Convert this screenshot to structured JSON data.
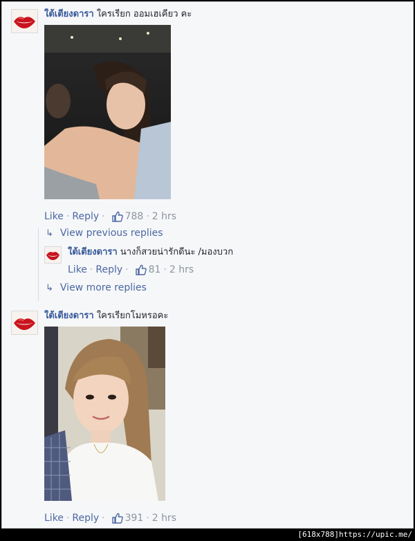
{
  "comments": [
    {
      "author": "ใต้เตียงดารา",
      "text": "ใครเรียก ออมเฮเคียว คะ",
      "like_label": "Like",
      "reply_label": "Reply",
      "like_count": "788",
      "time": "2 hrs",
      "photo_desc": "selfie-smiling-woman-dark-hair",
      "view_previous_replies": "View previous replies",
      "replies": [
        {
          "author": "ใต้เตียงดารา",
          "text": "นางก็สวยน่ารักดีนะ /มองบวก",
          "like_label": "Like",
          "reply_label": "Reply",
          "like_count": "81",
          "time": "2 hrs"
        }
      ],
      "view_more_replies": "View more replies"
    },
    {
      "author": "ใต้เตียงดารา",
      "text": "ใครเรียกโมหรอคะ",
      "like_label": "Like",
      "reply_label": "Reply",
      "like_count": "391",
      "time": "2 hrs",
      "photo_desc": "selfie-woman-white-top"
    }
  ],
  "icons": {
    "avatar": "red-lips-icon",
    "like": "thumbs-up-icon",
    "reply_arrow": "reply-arrow-icon"
  },
  "colors": {
    "author": "#365899",
    "link": "#4b67a1",
    "meta": "#8d949e",
    "background": "#f6f7f9"
  },
  "watermark": "[618x788]https://upic.me/"
}
